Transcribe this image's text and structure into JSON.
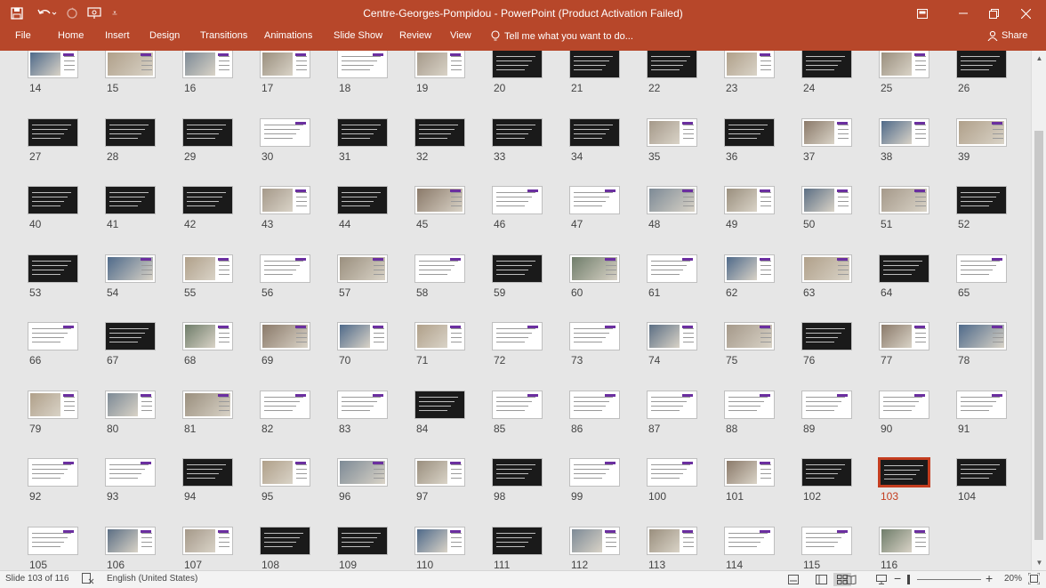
{
  "titlebar": {
    "title": "Centre-Georges-Pompidou - PowerPoint (Product Activation Failed)",
    "icons": [
      "save-icon",
      "undo-icon",
      "redo-icon",
      "present-icon",
      "customize-icon"
    ]
  },
  "ribbon": {
    "tabs": [
      "File",
      "Home",
      "Insert",
      "Design",
      "Transitions",
      "Animations",
      "Slide Show",
      "Review",
      "View"
    ],
    "tell_me": "Tell me what you want to do...",
    "share": "Share"
  },
  "slides": {
    "first": 14,
    "last": 116,
    "selected": 103
  },
  "status": {
    "slide_info": "Slide 103 of 116",
    "language": "English (United States)",
    "zoom": "20%",
    "zoom_minus": "−",
    "zoom_plus": "+"
  },
  "colors": {
    "accent": "#b7472a",
    "selection": "#c43d1f",
    "thumb_dark": "#1a1a1a",
    "thumb_light": "#ffffff",
    "slide_accent": "#6b2fa0"
  }
}
